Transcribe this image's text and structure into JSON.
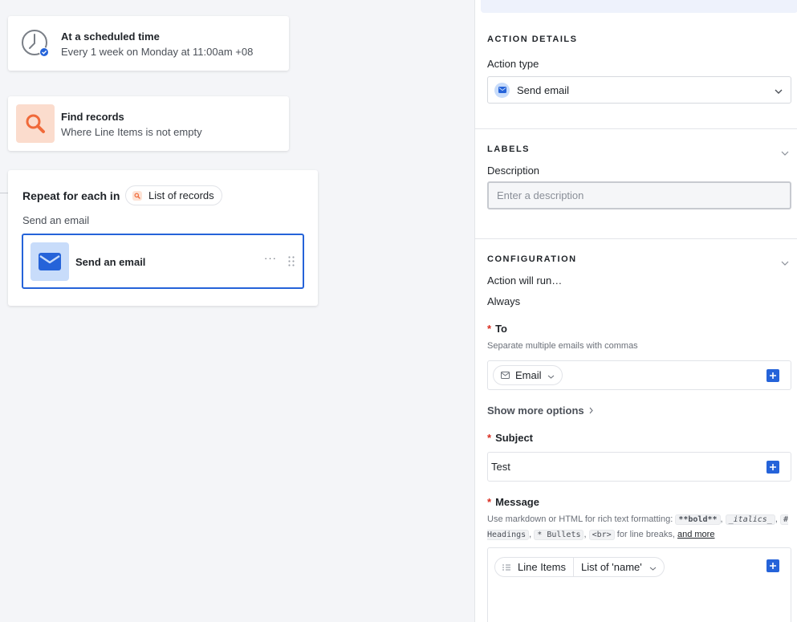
{
  "canvas": {
    "trigger": {
      "title": "At a scheduled time",
      "subtitle": "Every 1 week on Monday at 11:00am +08"
    },
    "find": {
      "title": "Find records",
      "subtitle": "Where Line Items is not empty"
    },
    "repeat": {
      "label": "Repeat for each in",
      "pill": "List of records",
      "description": "Send an email",
      "step": {
        "title": "Send an email",
        "more": "···"
      }
    }
  },
  "panel": {
    "action_details": {
      "heading": "ACTION DETAILS",
      "type_label": "Action type",
      "type_value": "Send email"
    },
    "labels": {
      "heading": "LABELS",
      "description_label": "Description",
      "description_placeholder": "Enter a description"
    },
    "configuration": {
      "heading": "CONFIGURATION",
      "run_label": "Action will run…",
      "run_value": "Always",
      "to": {
        "label": "To",
        "hint": "Separate multiple emails with commas",
        "chip": "Email"
      },
      "show_more": "Show more options",
      "subject": {
        "label": "Subject",
        "value": "Test"
      },
      "message": {
        "label": "Message",
        "hint_prefix": "Use markdown or HTML for rich text formatting:",
        "codes": [
          "**bold**",
          "_italics_",
          "# Headings",
          "* Bullets",
          "<br>"
        ],
        "hint_line_breaks": "for line breaks,",
        "and_more": "and more",
        "chip_field": "Line Items",
        "chip_value": "List of 'name'"
      }
    }
  },
  "colors": {
    "accent": "#2563d9",
    "find_icon": "#f06a3a",
    "required": "#d92d20"
  }
}
